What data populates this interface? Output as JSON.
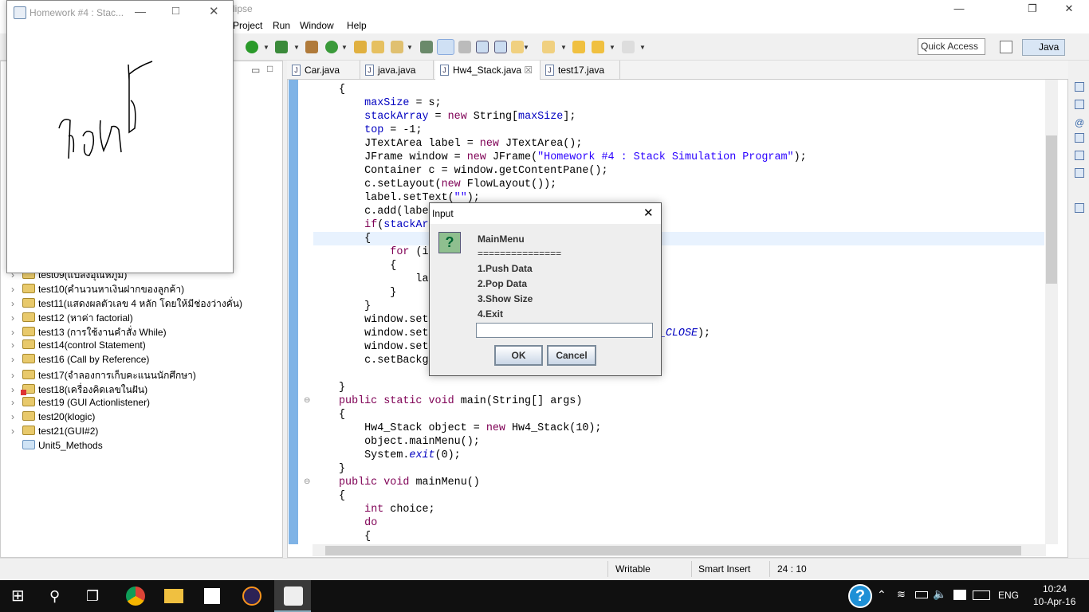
{
  "eclipse": {
    "title_fragment": "lipse",
    "menu": [
      "Project",
      "Run",
      "Window",
      "Help"
    ],
    "quick_access": "Quick Access",
    "perspective": "Java"
  },
  "tree": [
    {
      "label": "test09(แปลงอุณหภูมิ)",
      "state": "warning"
    },
    {
      "label": "test10(คำนวนหาเงินฝากของลูกค้า)",
      "state": "warning"
    },
    {
      "label": "test11(แสดงผลตัวเลข 4 หลัก โดยให้มีช่องว่างคั่น)",
      "state": "warning"
    },
    {
      "label": "test12 (หาค่า factorial)",
      "state": "warning"
    },
    {
      "label": "test13 (การใช้งานคำสั่ง While)",
      "state": "warning"
    },
    {
      "label": "test14(control Statement)",
      "state": "warning"
    },
    {
      "label": "test16 (Call by Reference)",
      "state": "warning"
    },
    {
      "label": "test17(จำลองการเก็บคะแนนนักศึกษา)",
      "state": "warning"
    },
    {
      "label": "test18(เครื่องคิดเลขในฝัน)",
      "state": "error"
    },
    {
      "label": "test19 (GUI Actionlistener)",
      "state": "warning"
    },
    {
      "label": "test20(klogic)",
      "state": "warning"
    },
    {
      "label": "test21(GUI#2)",
      "state": "warning"
    },
    {
      "label": "Unit5_Methods",
      "state": "folder"
    }
  ],
  "tabs": [
    {
      "label": "Car.java"
    },
    {
      "label": "java.java"
    },
    {
      "label": "Hw4_Stack.java",
      "active": true
    },
    {
      "label": "test17.java"
    }
  ],
  "code": [
    [
      [
        "{",
        ""
      ]
    ],
    [
      [
        "    ",
        ""
      ],
      [
        "maxSize",
        "fld"
      ],
      [
        " = s;",
        ""
      ]
    ],
    [
      [
        "    ",
        ""
      ],
      [
        "stackArray",
        "fld"
      ],
      [
        " = ",
        ""
      ],
      [
        "new",
        "kw"
      ],
      [
        " String[",
        ""
      ],
      [
        "maxSize",
        "fld"
      ],
      [
        "];",
        ""
      ]
    ],
    [
      [
        "    ",
        ""
      ],
      [
        "top",
        "fld"
      ],
      [
        " = -1;",
        ""
      ]
    ],
    [
      [
        "    JTextArea label = ",
        ""
      ],
      [
        "new",
        "kw"
      ],
      [
        " JTextArea();",
        ""
      ]
    ],
    [
      [
        "    JFrame window = ",
        ""
      ],
      [
        "new",
        "kw"
      ],
      [
        " JFrame(",
        ""
      ],
      [
        "\"Homework #4 : Stack Simulation Program\"",
        "str"
      ],
      [
        ");",
        ""
      ]
    ],
    [
      [
        "    Container c = window.getContentPane();",
        ""
      ]
    ],
    [
      [
        "    c.setLayout(",
        ""
      ],
      [
        "new",
        "kw"
      ],
      [
        " FlowLayout());",
        ""
      ]
    ],
    [
      [
        "    label.setText(",
        ""
      ],
      [
        "\"\"",
        "str"
      ],
      [
        ");",
        ""
      ]
    ],
    [
      [
        "    c.add(labe",
        ""
      ]
    ],
    [
      [
        "    ",
        ""
      ],
      [
        "if",
        "kw"
      ],
      [
        "(",
        ""
      ],
      [
        "stackAr",
        "fld"
      ]
    ],
    [
      [
        "    {",
        ""
      ]
    ],
    [
      [
        "        ",
        ""
      ],
      [
        "for",
        "kw"
      ],
      [
        " (i",
        ""
      ]
    ],
    [
      [
        "        {",
        ""
      ]
    ],
    [
      [
        "            la",
        ""
      ]
    ],
    [
      [
        "        }",
        ""
      ]
    ],
    [
      [
        "    }",
        ""
      ]
    ],
    [
      [
        "    window.set",
        ""
      ]
    ],
    [
      [
        "    window.set",
        ""
      ],
      [
        "                                    ",
        ""
      ],
      [
        "_CLOSE",
        "cst"
      ],
      [
        ");",
        ""
      ]
    ],
    [
      [
        "    window.set",
        ""
      ]
    ],
    [
      [
        "    c.setBackg",
        ""
      ]
    ],
    [
      [
        "",
        ""
      ]
    ],
    [
      [
        "}",
        ""
      ]
    ],
    [
      [
        "public static void",
        "kw"
      ],
      [
        " main(String[] args)",
        ""
      ]
    ],
    [
      [
        "{",
        ""
      ]
    ],
    [
      [
        "    Hw4_Stack object = ",
        ""
      ],
      [
        "new",
        "kw"
      ],
      [
        " Hw4_Stack(10);",
        ""
      ]
    ],
    [
      [
        "    object.mainMenu();",
        ""
      ]
    ],
    [
      [
        "    System.",
        ""
      ],
      [
        "exit",
        "cst"
      ],
      [
        "(0);",
        ""
      ]
    ],
    [
      [
        "}",
        ""
      ]
    ],
    [
      [
        "public void",
        "kw"
      ],
      [
        " mainMenu()",
        ""
      ]
    ],
    [
      [
        "{",
        ""
      ]
    ],
    [
      [
        "    ",
        ""
      ],
      [
        "int",
        "kw"
      ],
      [
        " choice;",
        ""
      ]
    ],
    [
      [
        "    ",
        ""
      ],
      [
        "do",
        "kw"
      ]
    ],
    [
      [
        "    {",
        ""
      ]
    ]
  ],
  "status": {
    "mode": "Writable",
    "insert": "Smart Insert",
    "position": "24 : 10"
  },
  "homework_window": {
    "title": "Homework #4 : Stac..."
  },
  "dialog": {
    "title": "Input",
    "lines": [
      "MainMenu",
      "===============",
      "1.Push Data",
      "2.Pop Data",
      "3.Show Size",
      "4.Exit"
    ],
    "input_value": "",
    "ok": "OK",
    "cancel": "Cancel"
  },
  "taskbar": {
    "lang": "ENG",
    "time": "10:24",
    "date": "10-Apr-16"
  },
  "colors": {
    "keyword": "#7f0055",
    "field": "#0000c0",
    "string": "#2a00ff",
    "taskbar": "#101010"
  }
}
